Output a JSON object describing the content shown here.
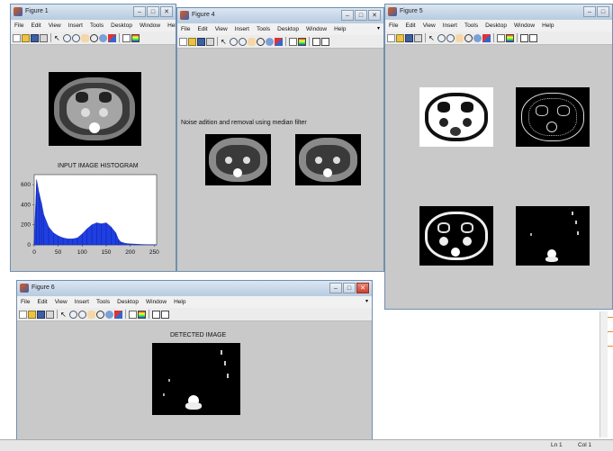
{
  "menu_labels": [
    "File",
    "Edit",
    "View",
    "Insert",
    "Tools",
    "Desktop",
    "Window",
    "Help"
  ],
  "figure1": {
    "title": "Figure 1",
    "plot_title": "INPUT IMAGE HISTOGRAM"
  },
  "figure4": {
    "title": "Figure 4",
    "caption": "Noise adition and removal using median filter"
  },
  "figure5": {
    "title": "Figure 5"
  },
  "figure6": {
    "title": "Figure 6",
    "image_title": "DETECTED IMAGE"
  },
  "statusbar": {
    "ln": "Ln 1",
    "col": "Col 1"
  },
  "colors": {
    "histogram_fill": "#1f3fe0",
    "window_bg": "#c9c9c9",
    "accent_orange": "#e38b2e"
  },
  "chart_data": {
    "type": "area",
    "title": "INPUT IMAGE HISTOGRAM",
    "xlim": [
      0,
      255
    ],
    "ylim": [
      0,
      700
    ],
    "xticks": [
      0,
      50,
      100,
      150,
      200,
      250
    ],
    "yticks": [
      0,
      200,
      400,
      600
    ],
    "x": [
      0,
      5,
      10,
      15,
      20,
      30,
      40,
      50,
      60,
      70,
      80,
      90,
      100,
      110,
      120,
      130,
      140,
      150,
      160,
      170,
      175,
      180,
      190,
      200,
      210,
      220,
      230,
      240,
      250,
      255
    ],
    "values": [
      40,
      650,
      520,
      420,
      300,
      180,
      120,
      90,
      70,
      60,
      60,
      70,
      110,
      160,
      200,
      220,
      210,
      220,
      180,
      120,
      60,
      30,
      15,
      10,
      8,
      5,
      3,
      2,
      2,
      0
    ]
  }
}
